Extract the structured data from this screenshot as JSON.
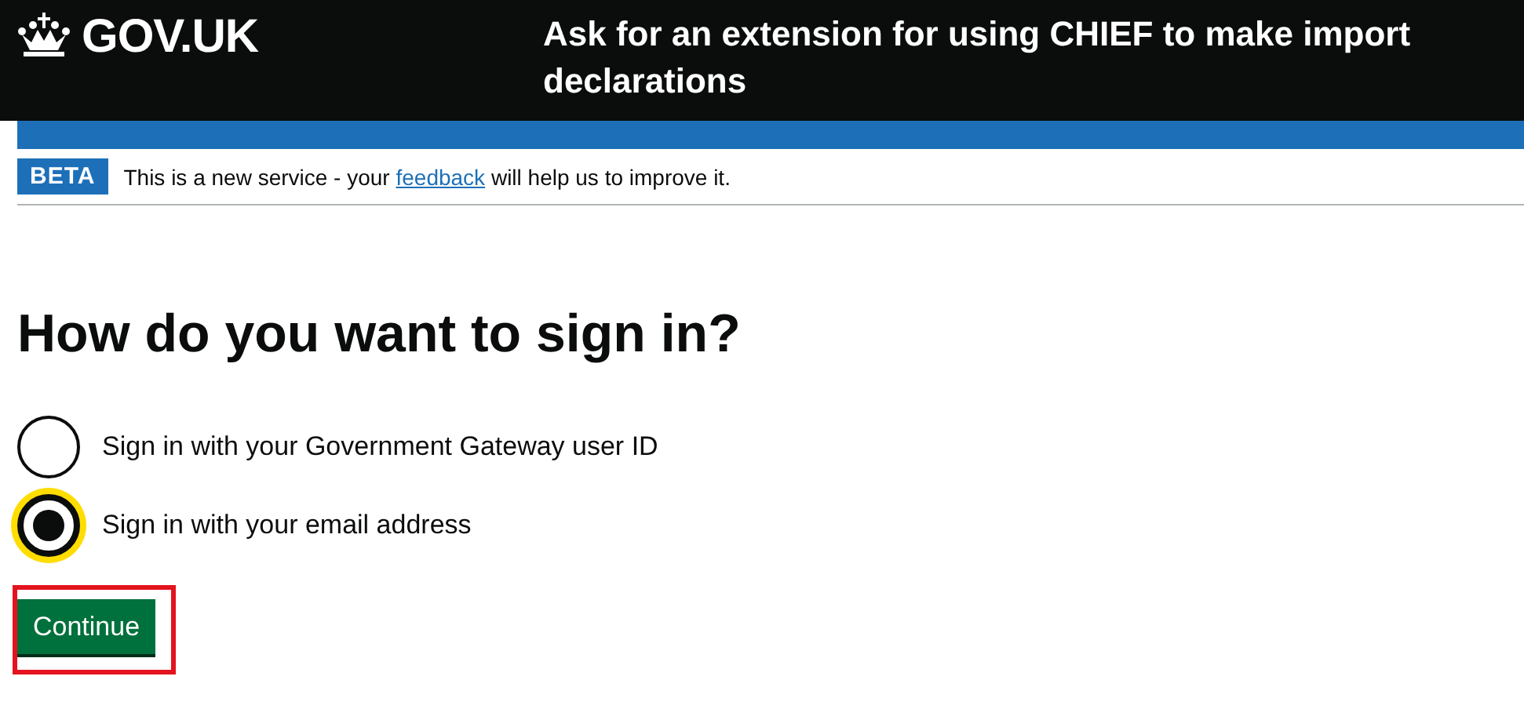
{
  "header": {
    "logo": "GOV.UK",
    "service_name": "Ask for an extension for using CHIEF to make import declarations"
  },
  "phase_banner": {
    "tag": "BETA",
    "text_before": "This is a new service - your",
    "link": "feedback",
    "text_after": "will help us to improve it."
  },
  "heading": "How do you want to sign in?",
  "options": [
    {
      "label": "Sign in with your Government Gateway user ID",
      "selected": false,
      "focused": false
    },
    {
      "label": "Sign in with your email address",
      "selected": true,
      "focused": true
    }
  ],
  "button": {
    "label": "Continue",
    "highlighted": true
  }
}
